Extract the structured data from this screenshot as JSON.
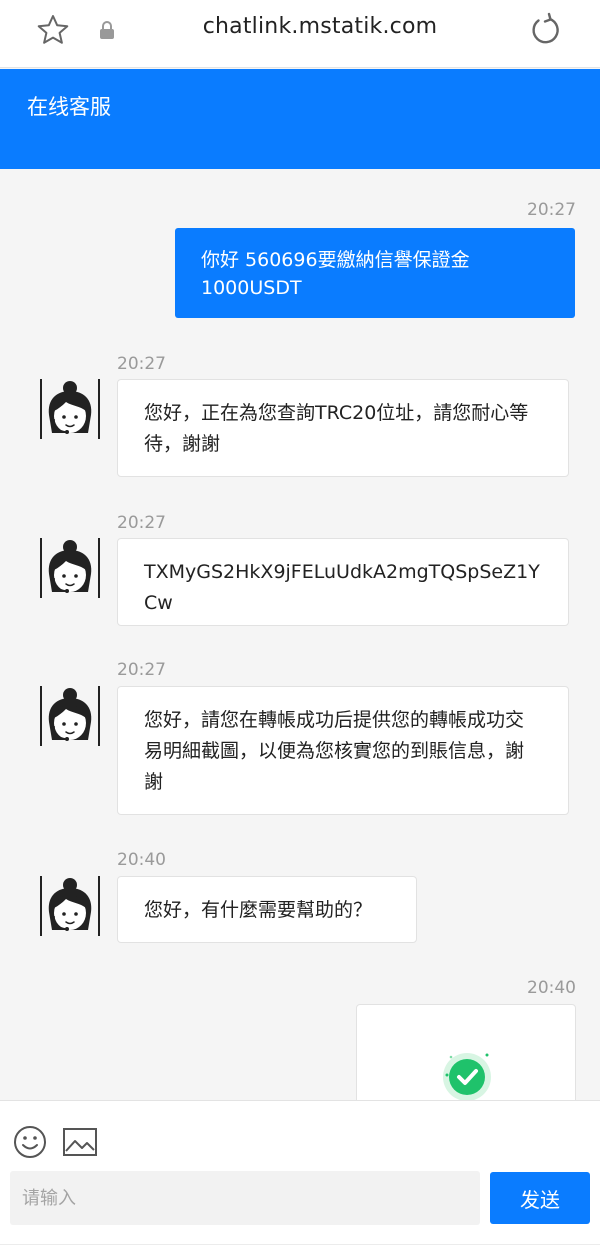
{
  "browser": {
    "url": "chatlink.mstatik.com",
    "icons": [
      "star-icon",
      "lock-icon",
      "reload-icon"
    ]
  },
  "header": {
    "title": "在线客服",
    "color": "#0a7cff"
  },
  "messages": [
    {
      "direction": "outgoing",
      "time": "20:27",
      "text": "你好 560696要繳納信譽保證金 1000USDT"
    },
    {
      "direction": "incoming",
      "time": "20:27",
      "text": "您好，正在為您查詢TRC20位址，請您耐心等待，謝謝"
    },
    {
      "direction": "incoming",
      "time": "20:27",
      "text": "TXMyGS2HkX9jFELuUdkA2mgTQSpSeZ1YCw"
    },
    {
      "direction": "incoming",
      "time": "20:27",
      "text": "您好，請您在轉帳成功后提供您的轉帳成功交易明細截圖，以便為您核實您的到賬信息，謝謝"
    },
    {
      "direction": "incoming",
      "time": "20:40",
      "text": "您好，有什麼需要幫助的？"
    },
    {
      "direction": "outgoing",
      "time": "20:40",
      "type": "image",
      "icon": "check-circle-icon"
    }
  ],
  "composer": {
    "placeholder": "请输入",
    "value": "",
    "send_label": "发送",
    "icons": [
      "emoji-icon",
      "image-icon"
    ]
  }
}
